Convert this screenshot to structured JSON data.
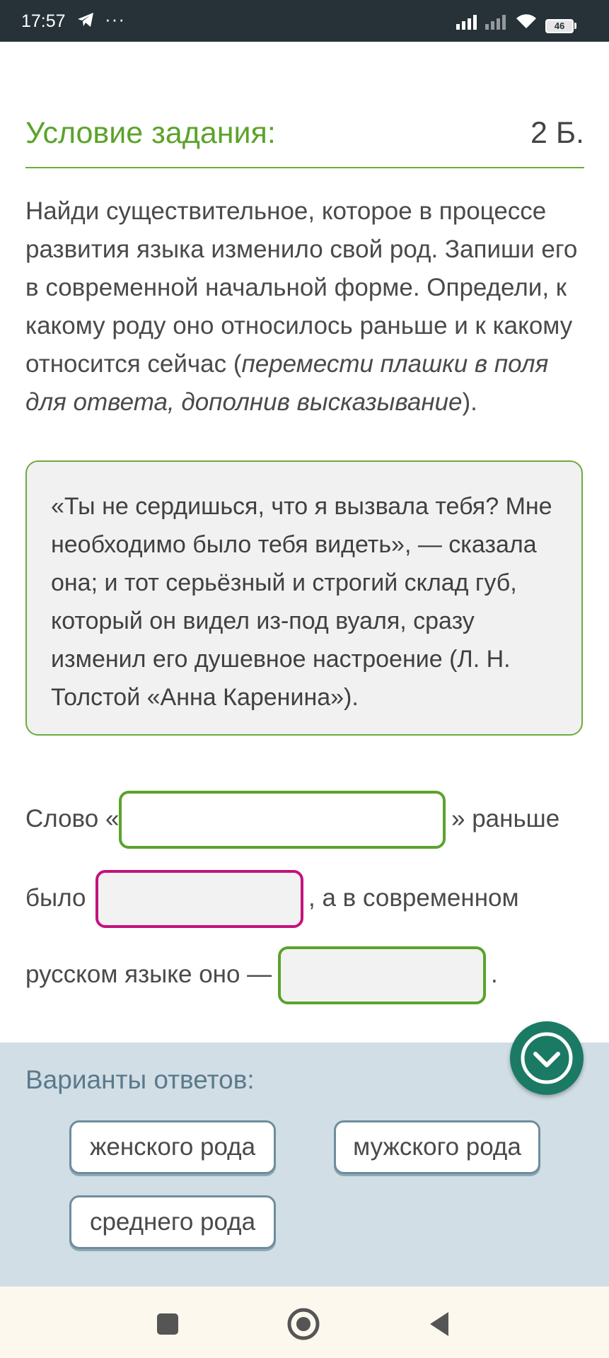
{
  "status_bar": {
    "time": "17:57",
    "dots": "···",
    "battery": "46",
    "icons": [
      "telegram-icon",
      "signal-icon",
      "signal-icon",
      "wifi-icon",
      "battery-icon"
    ]
  },
  "task": {
    "title": "Условие задания:",
    "points": "2 Б.",
    "text_plain": "Найди существительное, которое в процессе развития языка изменило свой род. Запиши его в современной начальной форме. Определи, к какому роду оно относилось раньше и к какому относится сейчас (",
    "text_italic": "перемести плашки в поля для ответа, дополнив высказывание",
    "text_end": ").",
    "quote": "«Ты не сердишься, что я вызвала тебя? Мне необходимо было тебя видеть», — сказала она; и тот серьёзный и строгий склад губ, который он видел из-под вуаля, сразу изменил его душевное настроение (Л. Н. Толстой «Анна Каренина»)."
  },
  "sentence": {
    "part1": "Слово «",
    "part2": "» раньше",
    "part3": "было",
    "part4": ", а в современном",
    "part5": "русском языке оно —",
    "part6": ".",
    "word_input_value": ""
  },
  "answers": {
    "title": "Варианты ответов:",
    "options": [
      "женского рода",
      "мужского рода",
      "среднего рода"
    ]
  },
  "fab": {
    "icon": "chevron-down-icon"
  },
  "nav": {
    "icons": [
      "recent-apps-icon",
      "home-icon",
      "back-icon"
    ]
  },
  "colors": {
    "accent_green": "#5ba32b",
    "magenta": "#c4127d",
    "fab": "#1b7a63",
    "panel": "#d1dee6",
    "status_bar": "#263238"
  }
}
